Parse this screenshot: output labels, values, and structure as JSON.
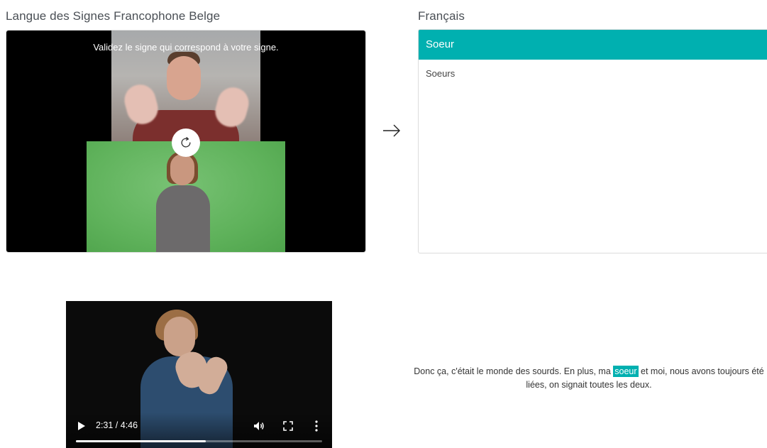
{
  "source": {
    "title": "Langue des Signes Francophone Belge",
    "instruction": "Validez le signe qui correspond à votre signe."
  },
  "target": {
    "title": "Français",
    "results": [
      {
        "label": "Soeur",
        "selected": true
      },
      {
        "label": "Soeurs",
        "selected": false
      }
    ]
  },
  "video": {
    "time": "2:31 / 4:46",
    "progress_fraction": 0.528
  },
  "caption": {
    "before": "Donc ça, c'était le monde des sourds. En plus, ma ",
    "highlight": "soeur",
    "after": " et moi, nous avons toujours été liées, on signait toutes les deux."
  },
  "colors": {
    "accent": "#00b0b0"
  },
  "icons": {
    "replay": "replay-icon",
    "arrow": "arrow-right-icon",
    "play": "play-icon",
    "volume": "volume-icon",
    "fullscreen": "fullscreen-icon",
    "more": "more-vertical-icon"
  }
}
